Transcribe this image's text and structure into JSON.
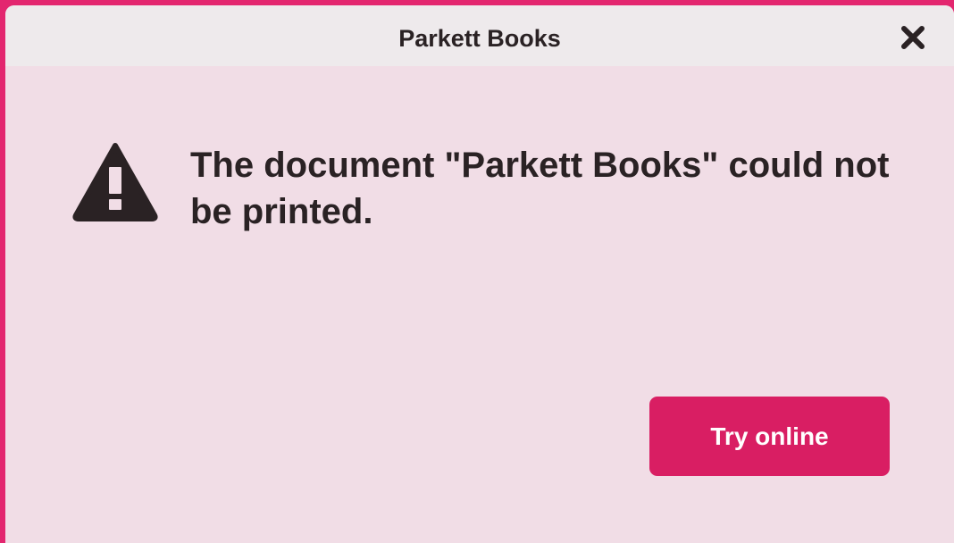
{
  "dialog": {
    "title": "Parkett Books",
    "close_icon": "close-icon",
    "warning_icon": "warning-triangle-icon",
    "message": "The document \"Parkett Books\" could not be printed.",
    "primary_button": "Try online"
  },
  "colors": {
    "frame": "#e3266f",
    "body": "#f1dde6",
    "titlebar": "#eeeaec",
    "text": "#2a2224",
    "button": "#d91e63"
  }
}
